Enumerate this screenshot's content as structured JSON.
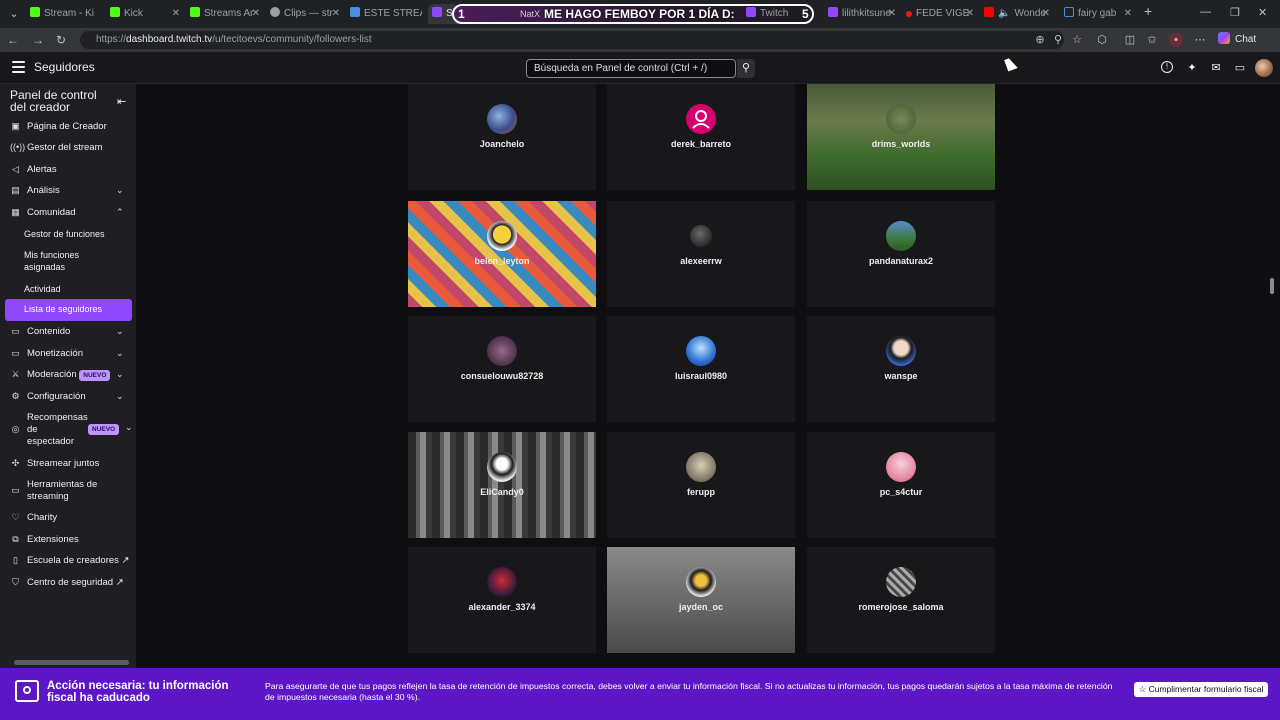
{
  "browser": {
    "tabs": [
      {
        "title": "Stream - Ki",
        "color": "#53fc18"
      },
      {
        "title": "Kick",
        "color": "#53fc18"
      },
      {
        "title": "Streams Ar",
        "color": "#53fc18"
      },
      {
        "title": "Clips — str",
        "color": "#9aa0a6"
      },
      {
        "title": "ESTE STREA",
        "color": "#4a90e2"
      },
      {
        "title": "Se",
        "color": "#9147ff"
      },
      {
        "title": "NatX",
        "color": "#9147ff"
      },
      {
        "title": "Twitch",
        "color": "#9147ff"
      },
      {
        "title": "lilithkitsune",
        "color": "#9147ff"
      },
      {
        "title": "FEDE VIGE",
        "color": "#e91916"
      },
      {
        "title": "Wonde",
        "color": "#ff0000"
      },
      {
        "title": "fairy gab",
        "color": "#4a90e2"
      }
    ],
    "overlay": {
      "left_number": "1",
      "text": "ME HAGO FEMBOY POR 1 DÍA D:",
      "right_number": "5"
    },
    "url_prefix": "https://",
    "url_host": "dashboard.twitch.tv",
    "url_path": "/u/tecitoevs/community/followers-list",
    "chat_label": "Chat"
  },
  "topbar": {
    "title": "Seguidores",
    "search_placeholder": "Búsqueda en Panel de control (Ctrl + /)"
  },
  "sidebar": {
    "title": "Panel de control del creador",
    "items": {
      "pagina": "Página de Creador",
      "gestor": "Gestor del stream",
      "alertas": "Alertas",
      "analisis": "Análisis",
      "comunidad": "Comunidad",
      "sub1": "Gestor de funciones",
      "sub2a": "Mis funciones",
      "sub2b": "asignadas",
      "sub3": "Actividad",
      "sub4": "Lista de seguidores",
      "contenido": "Contenido",
      "monetizacion": "Monetización",
      "moderacion": "Moderación",
      "configuracion": "Configuración",
      "recompensas_a": "Recompensas",
      "recompensas_b": "de",
      "recompensas_c": "espectador",
      "streamear": "Streamear juntos",
      "herramientas_a": "Herramientas de",
      "herramientas_b": "streaming",
      "charity": "Charity",
      "extensiones": "Extensiones",
      "escuela": "Escuela de creadores",
      "centro": "Centro de seguridad"
    },
    "badge_new": "NUEVO"
  },
  "followers": [
    "Joanchelo",
    "derek_barreto",
    "drims_worlds",
    "belen_leyton",
    "alexeerrw",
    "pandanaturax2",
    "consuelouwu82728",
    "luisraul0980",
    "wanspe",
    "EliCandy0",
    "ferupp",
    "pc_s4ctur",
    "alexander_3374",
    "jayden_oc",
    "romerojose_saloma"
  ],
  "banner": {
    "title": "Acción necesaria: tu información fiscal ha caducado",
    "text": "Para asegurarte de que tus pagos reflejen la tasa de retención de impuestos correcta, debes volver a enviar tu información fiscal. Si no actualizas tu información, tus pagos quedarán sujetos a la tasa máxima de retención de impuestos necesaria (hasta el 30 %).",
    "button": "Cumplimentar formulario fiscal"
  }
}
